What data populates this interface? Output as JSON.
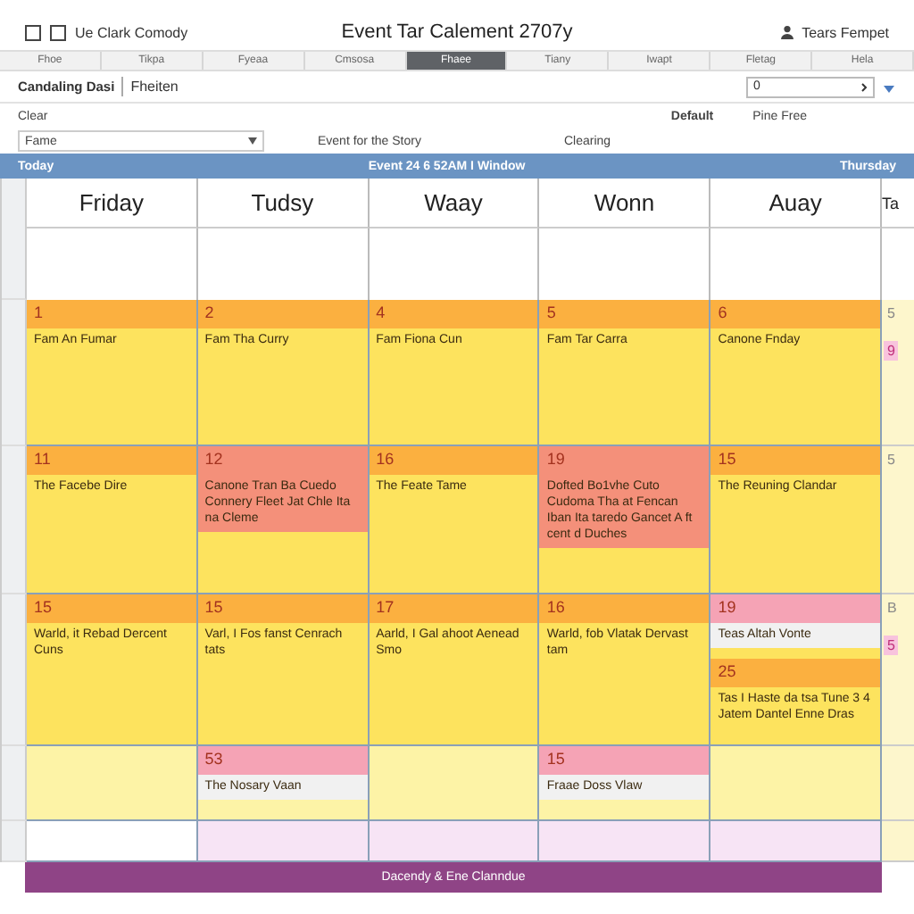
{
  "window": {
    "app_name": "Ue Clark Comody",
    "title": "Event Tar Calement 2707y",
    "user": "Tears Fempet"
  },
  "tabs": [
    {
      "label": "Fhoe",
      "selected": false
    },
    {
      "label": "Tikpa",
      "selected": false
    },
    {
      "label": "Fyeaa",
      "selected": false
    },
    {
      "label": "Cmsosa",
      "selected": false
    },
    {
      "label": "Fhaee",
      "selected": true
    },
    {
      "label": "Tiany",
      "selected": false
    },
    {
      "label": "Iwapt",
      "selected": false
    },
    {
      "label": "Fletag",
      "selected": false
    },
    {
      "label": "Hela",
      "selected": false
    }
  ],
  "toolbar": {
    "title": "Candaling Dasi",
    "subtitle": "Fheiten",
    "search_value": "0"
  },
  "filters": {
    "label": "Clear",
    "default_label": "Default",
    "default_value": "Pine Free",
    "dropdown_value": "Fame",
    "event_label": "Event for the Story",
    "status": "Clearing"
  },
  "banner": {
    "left": "Today",
    "center": "Event 24 6 52AM I Window",
    "right": "Thursday"
  },
  "days": [
    "Friday",
    "Tudsy",
    "Waay",
    "Wonn",
    "Auay"
  ],
  "partial_day": "Ta",
  "weeks": [
    {
      "kind": "main",
      "cells": [
        [
          {
            "kind": "normal",
            "day": "1",
            "text": "Fam An Fumar"
          }
        ],
        [
          {
            "kind": "normal",
            "day": "2",
            "text": "Fam Tha Curry"
          }
        ],
        [
          {
            "kind": "normal",
            "day": "4",
            "text": "Fam Fiona Cun"
          }
        ],
        [
          {
            "kind": "normal",
            "day": "5",
            "text": "Fam Tar Carra"
          }
        ],
        [
          {
            "kind": "normal",
            "day": "6",
            "text": "Canone Fnday"
          }
        ]
      ],
      "side": [
        {
          "kind": "plain",
          "text": "5"
        },
        {
          "kind": "pink",
          "text": "9"
        }
      ]
    },
    {
      "kind": "main",
      "cells": [
        [
          {
            "kind": "normal",
            "day": "11",
            "text": "The Facebe Dire"
          }
        ],
        [
          {
            "kind": "alert",
            "day": "12",
            "text": "Canone Tran Ba Cuedo Connery Fleet Jat Chle Ita na Cleme"
          }
        ],
        [
          {
            "kind": "normal",
            "day": "16",
            "text": "The Feate Tame"
          }
        ],
        [
          {
            "kind": "alert",
            "day": "19",
            "text": "Dofted Bo1vhe Cuto Cudoma Tha at Fencan Iban Ita taredo Gancet A ft cent d Duches"
          }
        ],
        [
          {
            "kind": "normal",
            "day": "15",
            "text": "The Reuning Clandar"
          }
        ]
      ],
      "side": [
        {
          "kind": "plain",
          "text": "5"
        }
      ]
    },
    {
      "kind": "main",
      "cells": [
        [
          {
            "kind": "normal",
            "day": "15",
            "text": "Warld, it Rebad Dercent Cuns"
          }
        ],
        [
          {
            "kind": "normal",
            "day": "15",
            "text": "Varl, I Fos fanst Cenrach tats"
          }
        ],
        [
          {
            "kind": "normal",
            "day": "17",
            "text": "Aarld, I Gal ahoot Aenead Smo"
          }
        ],
        [
          {
            "kind": "normal",
            "day": "16",
            "text": "Warld, fob Vlatak Dervast tam"
          }
        ],
        [
          {
            "kind": "note",
            "day": "19",
            "text": "Teas Altah Vonte"
          },
          {
            "kind": "normal",
            "day": "25",
            "text": "Tas I Haste da tsa Tune 3 4 Jatem Dantel Enne Dras"
          }
        ]
      ],
      "side": [
        {
          "kind": "plain",
          "text": "B"
        },
        {
          "kind": "pink",
          "text": "5"
        }
      ]
    },
    {
      "kind": "light",
      "cells": [
        [],
        [
          {
            "kind": "note",
            "day": "53",
            "text": "The Nosary Vaan"
          }
        ],
        [],
        [
          {
            "kind": "note",
            "day": "15",
            "text": "Fraae Doss Vlaw"
          }
        ],
        []
      ]
    },
    {
      "kind": "blank",
      "cells": [
        [],
        [],
        [],
        [],
        []
      ]
    }
  ],
  "footer": "Dacendy & Ene Clanndue"
}
